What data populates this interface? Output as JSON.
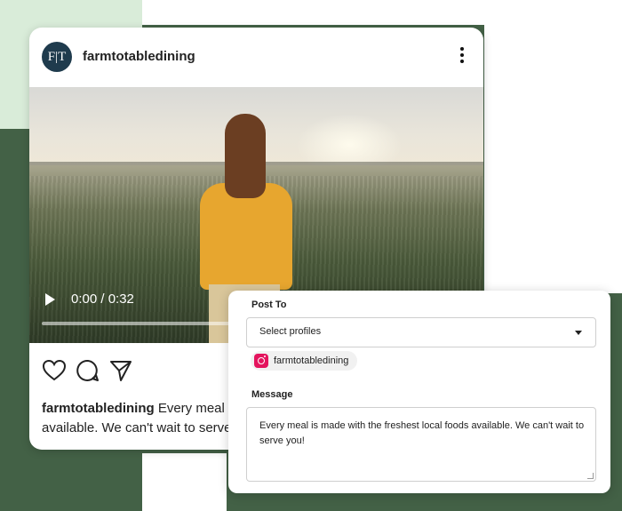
{
  "colors": {
    "background_green": "#436146",
    "mint": "#d9ecd9",
    "avatar": "#1f3b4d",
    "instagram": "#e4145e",
    "shirt": "#e7a62f"
  },
  "post": {
    "avatar_initials": "F|T",
    "username": "farmtotabledining",
    "more_icon": "more-vertical-icon",
    "video": {
      "current_time": "0:00",
      "duration": "0:32",
      "time_display": "0:00 / 0:32",
      "progress": 0
    },
    "actions": [
      "heart-icon",
      "comment-icon",
      "share-icon"
    ],
    "caption_username": "farmtotabledining",
    "caption_text": " Every meal is made with the freshest local foods available. We can't wait to serve you!"
  },
  "scheduler": {
    "post_to_label": "Post To",
    "select_placeholder": "Select profiles",
    "selected_profile": {
      "network_icon": "instagram-icon",
      "name": "farmtotabledining"
    },
    "message_label": "Message",
    "message_text": "Every meal is made with the freshest local foods available. We can't wait to serve you!"
  }
}
